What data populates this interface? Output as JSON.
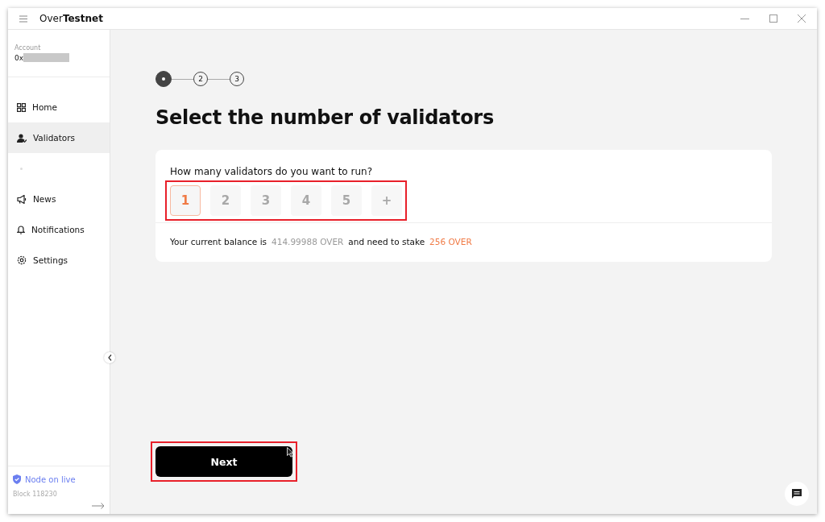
{
  "window": {
    "title": "Over**Testnet**"
  },
  "account": {
    "label": "Account",
    "address": "0x"
  },
  "sidebar": {
    "items": [
      {
        "label": "Home",
        "selected": false
      },
      {
        "label": "Validators",
        "selected": true
      },
      {
        "label": "News",
        "selected": false
      },
      {
        "label": "Notifications",
        "selected": false
      },
      {
        "label": "Settings",
        "selected": false
      }
    ],
    "node_status": "Node on live",
    "block": "Block 118230"
  },
  "steps": [
    {
      "selected": true
    },
    {
      "label": "2",
      "selected": false
    },
    {
      "label": "3",
      "selected": false
    }
  ],
  "heading": "Select the number of validators",
  "question": "How many validators do you want to run?",
  "options": [
    {
      "label": "1",
      "selected": true
    },
    {
      "label": "2",
      "selected": false
    },
    {
      "label": "3",
      "selected": false
    },
    {
      "label": "4",
      "selected": false
    },
    {
      "label": "5",
      "selected": false
    },
    {
      "label": "+",
      "selected": false
    }
  ],
  "balance": {
    "prefix": "Your current balance is",
    "amount": "414.99988 OVER",
    "middle": "and need to stake",
    "stake": "256 OVER"
  },
  "next_button": "Next"
}
